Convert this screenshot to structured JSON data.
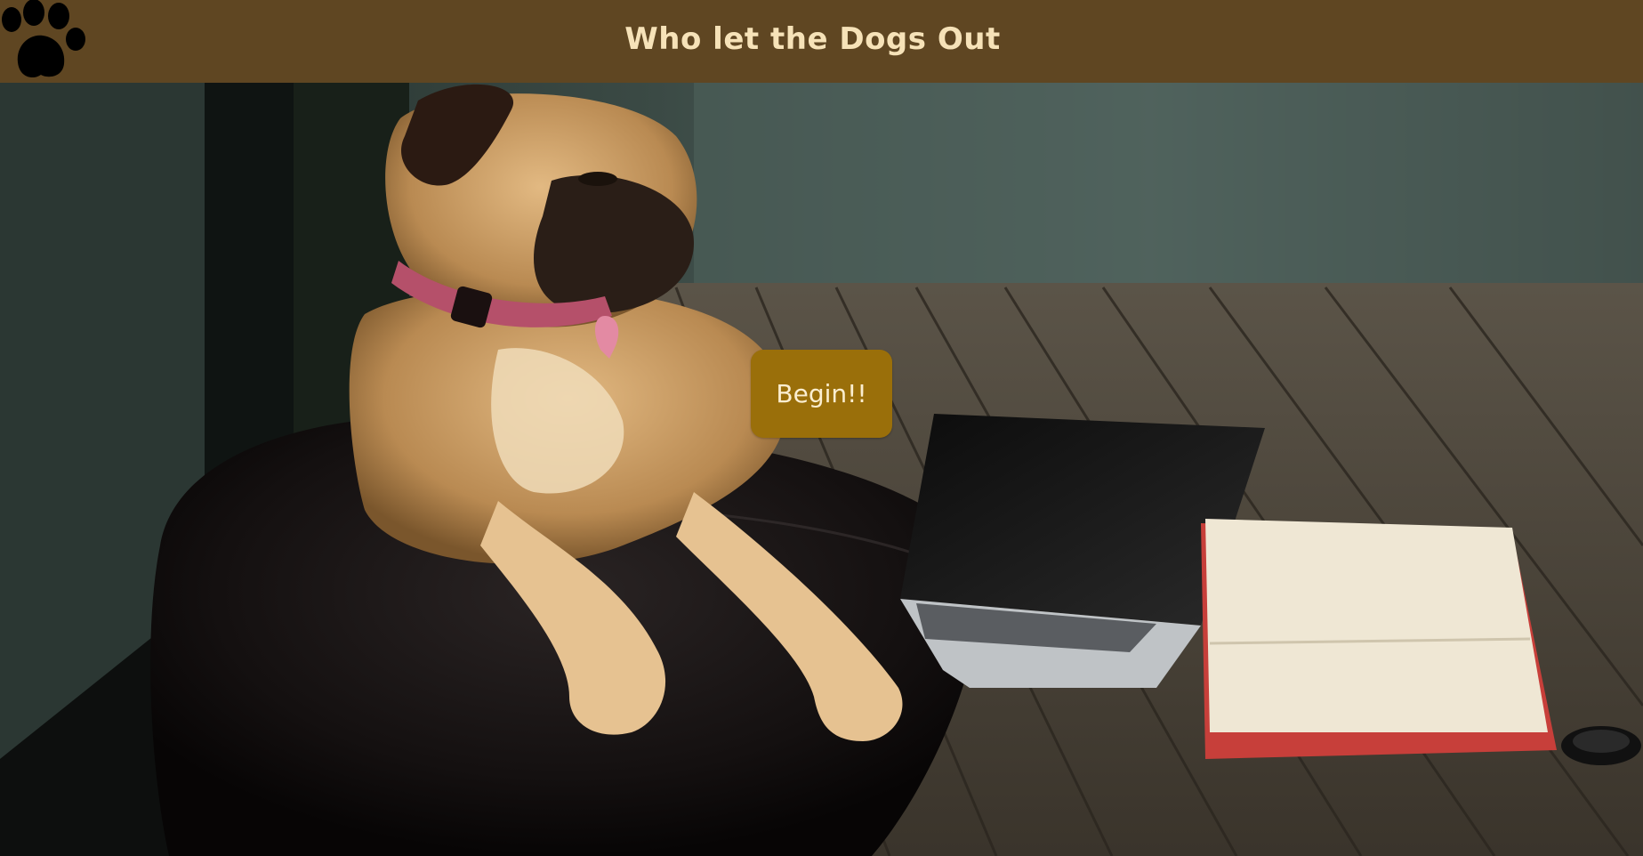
{
  "header": {
    "title": "Who let the Dogs Out",
    "logo_icon": "paw-print-icon",
    "background_color": "#5f4622",
    "title_color": "#f6e2b8"
  },
  "hero": {
    "image": "pug-on-beanbag-photo",
    "begin_label": "Begin!!",
    "button_color": "#9a6f0a",
    "button_text_color": "#fbeed0"
  }
}
